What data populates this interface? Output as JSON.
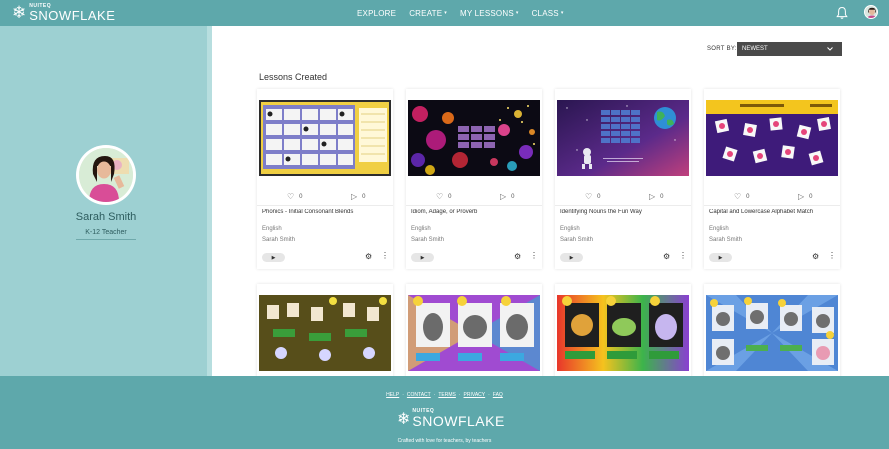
{
  "header": {
    "brand_top": "NUITEQ",
    "brand_main": "SNOWFLAKE",
    "nav": [
      {
        "label": "EXPLORE",
        "caret": false
      },
      {
        "label": "CREATE",
        "caret": true
      },
      {
        "label": "MY LESSONS",
        "caret": true
      },
      {
        "label": "CLASS",
        "caret": true
      }
    ],
    "icons": {
      "logo": "snowflake-icon",
      "notifications": "bell-icon",
      "caret": "chevron-down-icon"
    }
  },
  "profile": {
    "name": "Sarah Smith",
    "role": "K-12 Teacher"
  },
  "main": {
    "sort_label": "SORT BY:",
    "sort_value": "NEWEST",
    "section_title": "Lessons Created"
  },
  "lessons": [
    {
      "title": "Phonics - Initial Consonant Blends",
      "likes": "0",
      "plays": "0",
      "subject": "English",
      "author": "Sarah Smith",
      "thumb_theme": "yellow-grid-board"
    },
    {
      "title": "Idiom, Adage, or Proverb",
      "likes": "0",
      "plays": "0",
      "subject": "English",
      "author": "Sarah Smith",
      "thumb_theme": "bokeh-lights"
    },
    {
      "title": "Identifying Nouns the Fun Way",
      "likes": "0",
      "plays": "0",
      "subject": "English",
      "author": "Sarah Smith",
      "thumb_theme": "space-astronaut"
    },
    {
      "title": "Capital and Lowercase Alphabet Match",
      "likes": "0",
      "plays": "0",
      "subject": "English",
      "author": "Sarah Smith",
      "thumb_theme": "purple-letter-cards"
    },
    {
      "title": "",
      "likes": "",
      "plays": "",
      "subject": "",
      "author": "",
      "thumb_theme": "dark-letter-game"
    },
    {
      "title": "",
      "likes": "",
      "plays": "",
      "subject": "",
      "author": "",
      "thumb_theme": "colorful-animals"
    },
    {
      "title": "",
      "likes": "",
      "plays": "",
      "subject": "",
      "author": "",
      "thumb_theme": "rainbow-animals"
    },
    {
      "title": "",
      "likes": "",
      "plays": "",
      "subject": "",
      "author": "",
      "thumb_theme": "blue-animals"
    }
  ],
  "card_icons": {
    "like": "heart-icon",
    "play": "play-icon",
    "settings": "gear-icon",
    "more": "more-vertical-icon"
  },
  "footer": {
    "links": [
      "HELP",
      "CONTACT",
      "TERMS",
      "PRIVACY",
      "FAQ"
    ],
    "separator": "·",
    "brand_top": "NUITEQ",
    "brand_main": "SNOWFLAKE",
    "tagline": "Crafted with love for teachers, by teachers"
  },
  "colors": {
    "header": "#5ea8ab",
    "profile_panel": "#9dd0d2",
    "sort_select": "#4a4a4a",
    "card_bg": "#ffffff"
  }
}
